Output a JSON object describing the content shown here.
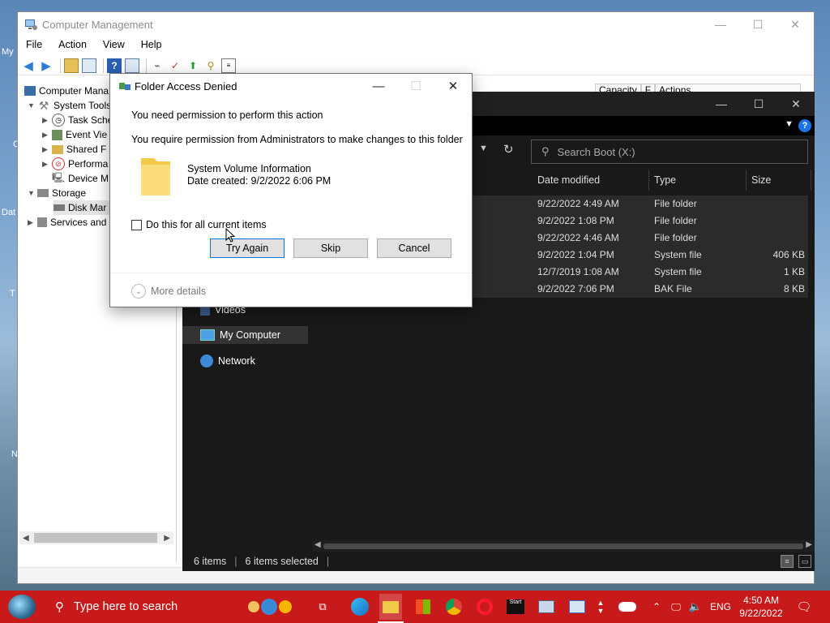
{
  "desktop": {
    "labels": [
      "My",
      "C",
      "Dat",
      "T",
      "N"
    ]
  },
  "computer_management": {
    "title": "Computer Management",
    "menu": [
      "File",
      "Action",
      "View",
      "Help"
    ],
    "tree": [
      {
        "label": "Computer Management (Local)",
        "shown": "Computer Mana"
      },
      {
        "label": "System Tools",
        "shown": "System Tools"
      },
      {
        "label": "Task Scheduler",
        "shown": "Task Sche"
      },
      {
        "label": "Event Viewer",
        "shown": "Event Vie"
      },
      {
        "label": "Shared Folders",
        "shown": "Shared F"
      },
      {
        "label": "Performance",
        "shown": "Performa"
      },
      {
        "label": "Device Manager",
        "shown": "Device M"
      },
      {
        "label": "Storage",
        "shown": "Storage"
      },
      {
        "label": "Disk Management",
        "shown": "Disk Mar"
      },
      {
        "label": "Services and Applications",
        "shown": "Services and"
      }
    ],
    "columns": [
      "Capacity",
      "F",
      "Actions"
    ]
  },
  "file_explorer": {
    "search_placeholder": "Search Boot (X:)",
    "columns": [
      "Date modified",
      "Type",
      "Size"
    ],
    "rows": [
      {
        "date": "9/22/2022 4:49 AM",
        "type": "File folder",
        "size": ""
      },
      {
        "date": "9/2/2022 1:08 PM",
        "type": "File folder",
        "size": ""
      },
      {
        "date": "9/22/2022 4:46 AM",
        "type": "File folder",
        "size": ""
      },
      {
        "date": "9/2/2022 1:04 PM",
        "type": "System file",
        "size": "406 KB"
      },
      {
        "date": "12/7/2019 1:08 AM",
        "type": "System file",
        "size": "1 KB"
      },
      {
        "date": "9/2/2022 7:06 PM",
        "type": "BAK File",
        "size": "8 KB"
      }
    ],
    "nav": [
      "Videos",
      "My Computer",
      "Network"
    ],
    "status": {
      "items": "6 items",
      "selected": "6 items selected"
    }
  },
  "dialog": {
    "title": "Folder Access Denied",
    "line1": "You need permission to perform this action",
    "line2": "You require permission from Administrators to make changes to this folder",
    "file_name": "System Volume Information",
    "date_created": "Date created: 9/2/2022 6:06 PM",
    "checkbox_label": "Do this for all current items",
    "checkbox_checked": false,
    "buttons": {
      "try_again": "Try Again",
      "skip": "Skip",
      "cancel": "Cancel"
    },
    "more_details": "More details"
  },
  "taskbar": {
    "search_placeholder": "Type here to search",
    "language": "ENG",
    "time": "4:50 AM",
    "date": "9/22/2022",
    "accent": "#c81a1a"
  }
}
